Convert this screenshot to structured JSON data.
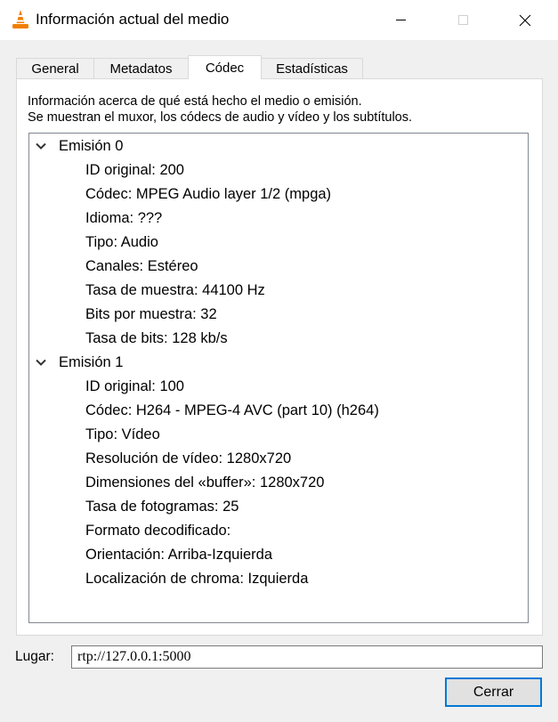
{
  "window": {
    "title": "Información actual del medio",
    "app_icon": "vlc-cone-icon",
    "controls": [
      "minimize-icon",
      "maximize-icon",
      "close-icon"
    ]
  },
  "tabs": [
    {
      "label": "General",
      "active": false
    },
    {
      "label": "Metadatos",
      "active": false
    },
    {
      "label": "Códec",
      "active": true
    },
    {
      "label": "Estadísticas",
      "active": false
    }
  ],
  "codec": {
    "description_line1": "Información acerca de qué está hecho el medio o emisión.",
    "description_line2": "Se muestran el muxor, los códecs de audio y vídeo y los subtítulos.",
    "streams": [
      {
        "label": "Emisión 0",
        "expanded": true,
        "items": [
          "ID original: 200",
          "Códec: MPEG Audio layer 1/2 (mpga)",
          "Idioma: ???",
          "Tipo: Audio",
          "Canales: Estéreo",
          "Tasa de muestra: 44100 Hz",
          "Bits por muestra: 32",
          "Tasa de bits: 128 kb/s"
        ]
      },
      {
        "label": "Emisión 1",
        "expanded": true,
        "items": [
          "ID original: 100",
          "Códec: H264 - MPEG-4 AVC (part 10) (h264)",
          "Tipo: Vídeo",
          "Resolución de vídeo: 1280x720",
          "Dimensiones del «buffer»: 1280x720",
          "Tasa de fotogramas: 25",
          "Formato decodificado:",
          "Orientación: Arriba-Izquierda",
          "Localización de chroma: Izquierda"
        ]
      }
    ]
  },
  "location": {
    "label": "Lugar:",
    "value": "rtp://127.0.0.1:5000"
  },
  "buttons": {
    "close_label": "Cerrar"
  },
  "colors": {
    "accent": "#0078d7",
    "vlc_orange": "#f07f00",
    "background": "#f0f0f0"
  }
}
